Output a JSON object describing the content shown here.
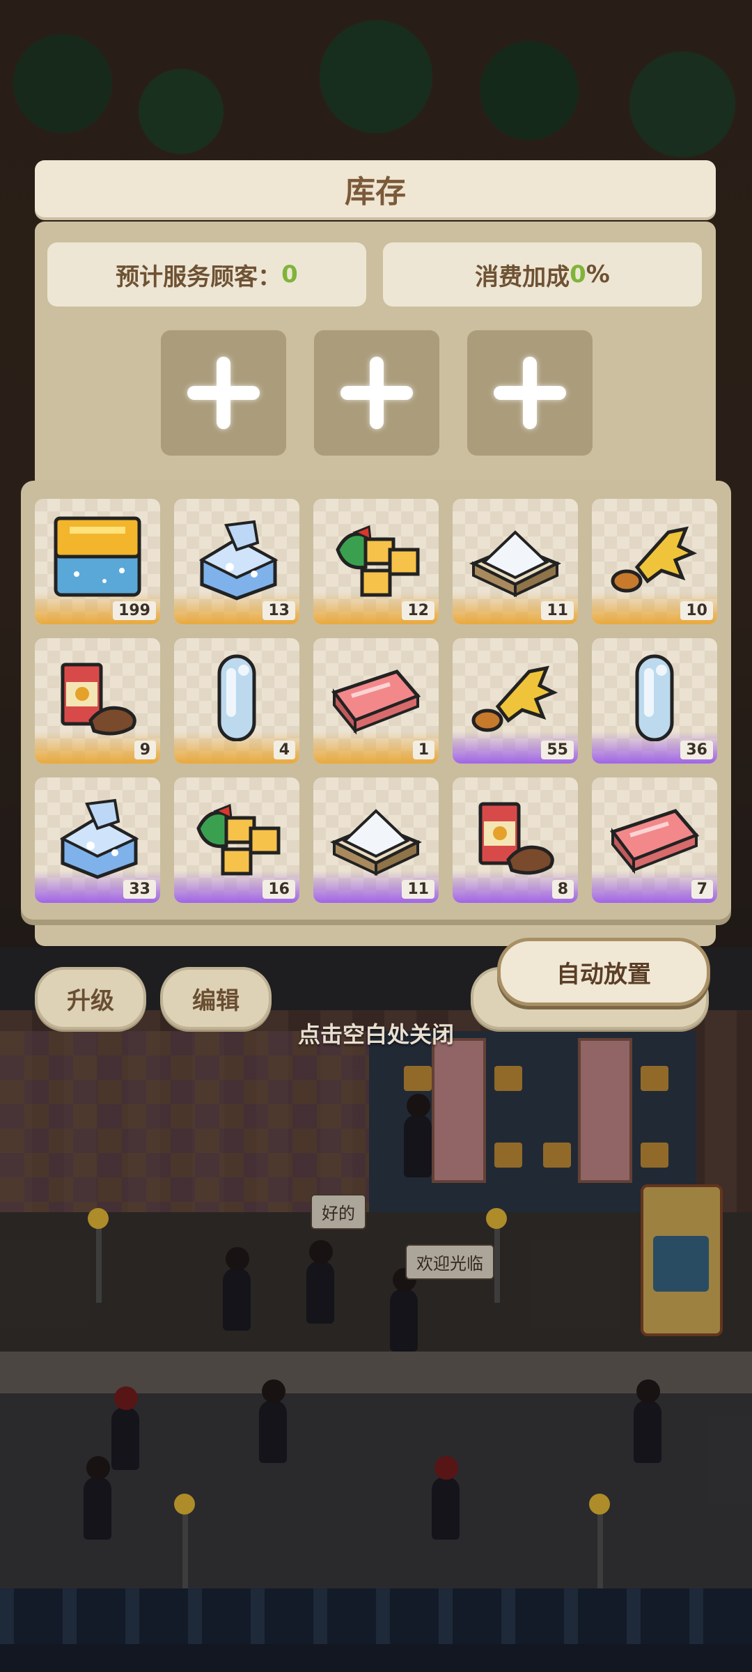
{
  "inventory": {
    "title": "库存",
    "served_label": "预计服务顾客：",
    "served_value": "0",
    "bonus_label": "消费加成",
    "bonus_value": "0",
    "bonus_unit": "%",
    "slots": [
      "add-slot",
      "add-slot",
      "add-slot"
    ],
    "items": [
      {
        "icon": "gold-crate-icon",
        "count": "199",
        "rarity": "gold"
      },
      {
        "icon": "milk-carton-icon",
        "count": "13",
        "rarity": "gold"
      },
      {
        "icon": "cheese-cubes-icon",
        "count": "12",
        "rarity": "gold"
      },
      {
        "icon": "sugar-tray-icon",
        "count": "11",
        "rarity": "gold"
      },
      {
        "icon": "crispy-chicken-icon",
        "count": "10",
        "rarity": "gold"
      },
      {
        "icon": "coffee-bag-icon",
        "count": "9",
        "rarity": "gold"
      },
      {
        "icon": "water-bottle-icon",
        "count": "4",
        "rarity": "gold"
      },
      {
        "icon": "meat-block-icon",
        "count": "1",
        "rarity": "gold"
      },
      {
        "icon": "crispy-chicken-icon",
        "count": "55",
        "rarity": "purple"
      },
      {
        "icon": "water-bottle-icon",
        "count": "36",
        "rarity": "purple"
      },
      {
        "icon": "milk-carton-icon",
        "count": "33",
        "rarity": "purple"
      },
      {
        "icon": "cheese-cubes-icon",
        "count": "16",
        "rarity": "purple"
      },
      {
        "icon": "sugar-tray-icon",
        "count": "11",
        "rarity": "purple"
      },
      {
        "icon": "coffee-bag-icon",
        "count": "8",
        "rarity": "purple"
      },
      {
        "icon": "meat-block-icon",
        "count": "7",
        "rarity": "purple"
      }
    ],
    "auto_place_label": "自动放置"
  },
  "shop": {
    "upgrade_label": "升级",
    "edit_label": "编辑",
    "close_hint": "点击空白处关闭",
    "speech_ok": "好的",
    "speech_welcome": "欢迎光临"
  },
  "colors": {
    "title_text": "#7a5a3a",
    "value_green": "#7fb43a",
    "rarity_gold": "#e9a93c",
    "rarity_purple": "#a064e6"
  }
}
